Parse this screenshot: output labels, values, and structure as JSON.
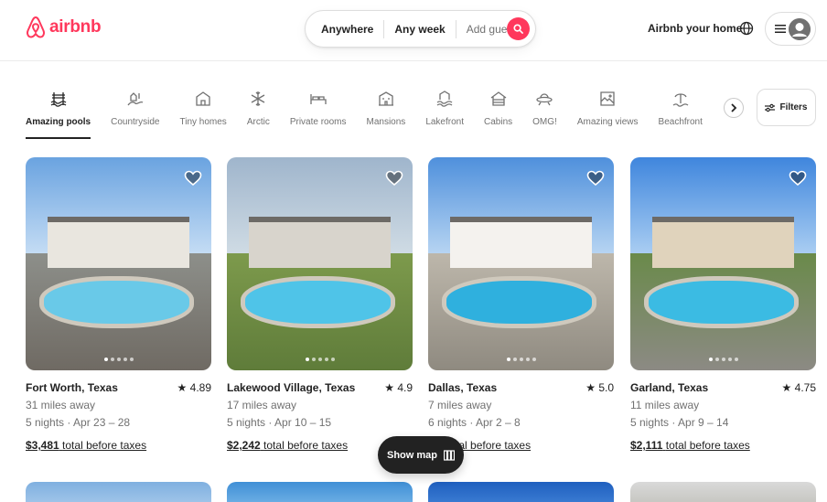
{
  "header": {
    "logo_text": "airbnb",
    "search": {
      "where": "Anywhere",
      "when": "Any week",
      "who": "Add guests"
    },
    "host_link": "Airbnb your home",
    "icons": [
      "globe-icon",
      "menu-icon",
      "avatar-icon",
      "search-icon"
    ]
  },
  "categories": [
    {
      "label": "Amazing pools",
      "icon": "pool-icon",
      "active": true
    },
    {
      "label": "Countryside",
      "icon": "countryside-icon"
    },
    {
      "label": "Tiny homes",
      "icon": "tiny-home-icon"
    },
    {
      "label": "Arctic",
      "icon": "snowflake-icon"
    },
    {
      "label": "Private rooms",
      "icon": "bed-icon"
    },
    {
      "label": "Mansions",
      "icon": "mansion-icon"
    },
    {
      "label": "Lakefront",
      "icon": "lakefront-icon"
    },
    {
      "label": "Cabins",
      "icon": "cabin-icon"
    },
    {
      "label": "OMG!",
      "icon": "ufo-icon"
    },
    {
      "label": "Amazing views",
      "icon": "views-icon"
    },
    {
      "label": "Beachfront",
      "icon": "beach-icon"
    }
  ],
  "filters_label": "Filters",
  "listings": [
    {
      "location": "Fort Worth, Texas",
      "rating": "4.89",
      "distance": "31 miles away",
      "dates": "5 nights · Apr 23 – 28",
      "price": "$3,481",
      "price_suffix": "total before taxes"
    },
    {
      "location": "Lakewood Village, Texas",
      "rating": "4.9",
      "distance": "17 miles away",
      "dates": "5 nights · Apr 10 – 15",
      "price": "$2,242",
      "price_suffix": "total before taxes"
    },
    {
      "location": "Dallas, Texas",
      "rating": "5.0",
      "distance": "7 miles away",
      "dates": "6 nights · Apr 2 – 8",
      "price": "$...",
      "price_suffix": "total before taxes"
    },
    {
      "location": "Garland, Texas",
      "rating": "4.75",
      "distance": "11 miles away",
      "dates": "5 nights · Apr 9 – 14",
      "price": "$2,111",
      "price_suffix": "total before taxes"
    }
  ],
  "show_map_label": "Show map",
  "colors": {
    "brand": "#ff385c",
    "text": "#222222",
    "muted": "#717171"
  }
}
